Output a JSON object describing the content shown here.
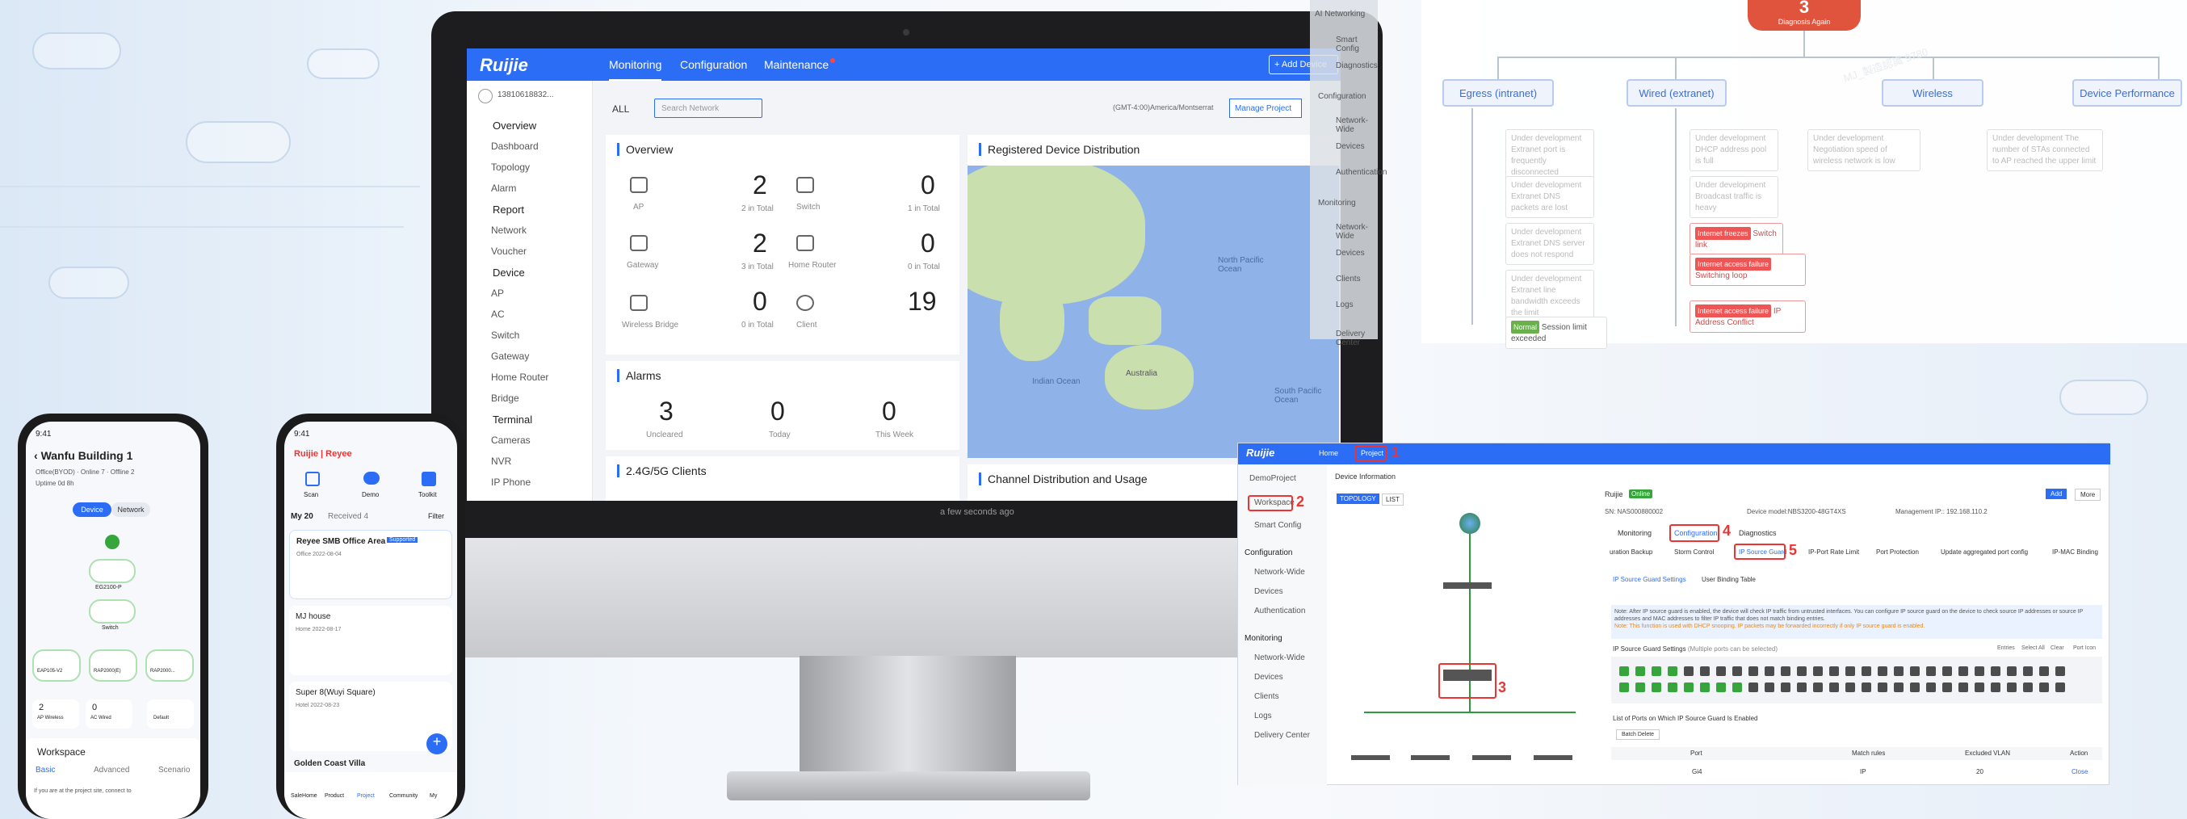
{
  "colors": {
    "accent": "#2c6df6",
    "alert": "#e33333",
    "ok": "#35a53c"
  },
  "monitor": {
    "logo": "Ruijie",
    "nav": [
      "Monitoring",
      "Configuration",
      "Maintenance"
    ],
    "add_device": "+ Add Device",
    "user": "13810618832...",
    "filter": "ALL",
    "search_placeholder": "Search Network",
    "timezone": "(GMT-4:00)America/Montserrat",
    "manage_project": "Manage Project",
    "sidebar": {
      "overview": "Overview",
      "overview_items": [
        "Dashboard",
        "Topology",
        "Alarm"
      ],
      "report": "Report",
      "report_items": [
        "Network",
        "Voucher"
      ],
      "device": "Device",
      "device_items": [
        "AP",
        "AC",
        "Switch",
        "Gateway",
        "Home Router",
        "Bridge"
      ],
      "terminal": "Terminal",
      "terminal_items": [
        "Cameras",
        "NVR",
        "IP Phone"
      ]
    },
    "overview": {
      "title": "Overview",
      "items": [
        {
          "label": "AP",
          "value": "2",
          "total": "2 in Total"
        },
        {
          "label": "Switch",
          "value": "0",
          "total": "1 in Total"
        },
        {
          "label": "Gateway",
          "value": "2",
          "total": "3 in Total"
        },
        {
          "label": "Home Router",
          "value": "0",
          "total": "0 in Total"
        },
        {
          "label": "Wireless Bridge",
          "value": "0",
          "total": "0 in Total"
        },
        {
          "label": "Client",
          "value": "19",
          "total": ""
        }
      ]
    },
    "alarms": {
      "title": "Alarms",
      "items": [
        {
          "value": "3",
          "label": "Uncleared"
        },
        {
          "value": "0",
          "label": "Today"
        },
        {
          "value": "0",
          "label": "This Week"
        }
      ]
    },
    "clients_title": "2.4G/5G Clients",
    "map_title": "Registered Device Distribution",
    "map_labels": [
      "North Pacific Ocean",
      "Indian Ocean",
      "South Pacific Ocean",
      "Australia"
    ],
    "channel_title": "Channel Distribution and Usage",
    "updated": "a few seconds ago"
  },
  "overlay": {
    "items": [
      "AI Networking",
      "Smart Config",
      "Diagnostics",
      "Configuration",
      "Network-Wide",
      "Devices",
      "Authentication",
      "Monitoring",
      "Network-Wide",
      "Devices",
      "Clients",
      "Logs",
      "Delivery Center"
    ]
  },
  "diagram": {
    "root": "3",
    "root_sub": "Diagnosis Again",
    "categories": [
      "Egress (intranet)",
      "Wired (extranet)",
      "Wireless",
      "Device Performance"
    ],
    "egress": [
      "Under development Extranet port is frequently disconnected",
      "Under development Extranet DNS packets are lost",
      "Under development Extranet DNS server does not respond",
      "Under development Extranet line bandwidth exceeds the limit"
    ],
    "normal": "Normal",
    "normal_text": "Session limit exceeded",
    "wired": [
      "Under development DHCP address pool is full",
      "Under development Broadcast traffic is heavy"
    ],
    "wired_alerts": [
      {
        "tag": "Internet freezes",
        "text": "Switch link"
      },
      {
        "tag": "Internet access failure",
        "text": "Switching loop"
      },
      {
        "tag": "Internet access failure",
        "text": "IP Address Conflict"
      }
    ],
    "wireless": "Under development Negotiation speed of wireless network is low",
    "perf": "Under development The number of STAs connected to AP reached the upper limit",
    "watermark": "MJ_製造認識 9780"
  },
  "shot": {
    "nav": [
      "Home",
      "Project"
    ],
    "side": [
      "DemoProject",
      "Workspace",
      "Smart Config",
      "Configuration",
      "Network-Wide",
      "Devices",
      "Authentication",
      "Monitoring",
      "Network-Wide",
      "Devices",
      "Clients",
      "Logs",
      "Delivery Center"
    ],
    "header": "Device Information",
    "tabs_left": [
      "TOPOLOGY",
      "LIST"
    ],
    "device_title": "Ruijie",
    "status": "Online",
    "sn": "SN: NAS000880002",
    "model": "Device model:NBS3200-48GT4XS",
    "ip": "Management IP:: 192.168.110.2",
    "tabs": [
      "Monitoring",
      "Configuration",
      "Diagnostics"
    ],
    "subtabs": [
      "uration Backup",
      "Storm Control",
      "IP Source Guard",
      "IP-Port Rate Limit",
      "Port Protection",
      "Update aggregated port config",
      "IP-MAC Binding"
    ],
    "inner_tabs": [
      "IP Source Guard Settings",
      "User Binding Table"
    ],
    "note": "Note: After IP source guard is enabled, the device will check IP traffic from untrusted interfaces. You can configure IP source guard on the device to check source IP addresses or source IP addresses and MAC addresses to filter IP traffic that does not match binding entries.",
    "note2": "Note: This function is used with DHCP snooping. IP packets may be forwarded incorrectly if only IP source guard is enabled.",
    "settings_label": "IP Source Guard Settings",
    "settings_hint": "(Multiple ports can be selected)",
    "legend": [
      "Entries",
      "Select All",
      "Clear",
      "Port Icon"
    ],
    "list_title": "List of Ports on Which IP Source Guard Is Enabled",
    "batch": "Batch Delete",
    "columns": [
      "Port",
      "Match rules",
      "Excluded VLAN",
      "Action"
    ],
    "row": [
      "Gi4",
      "IP",
      "20",
      "Close"
    ],
    "steps": [
      "1",
      "2",
      "3",
      "4",
      "5"
    ],
    "btn": "Add",
    "more": "More"
  },
  "phone1": {
    "time": "9:41",
    "title": "Wanfu Building 1",
    "meta": [
      "Office(BYOD)",
      "Online 7",
      "Offline 2"
    ],
    "uptime": "Uptime 0d 8h",
    "toggle": [
      "Device",
      "Network"
    ],
    "nodes": [
      "EG2100-P",
      "Switch"
    ],
    "leaves": [
      "EAP105-V2",
      "RAP2000(E)",
      "RAP2000..."
    ],
    "stats": [
      {
        "v": "2",
        "l": "AP Wireless"
      },
      {
        "v": "0",
        "l": "AC Wired"
      },
      {
        "v": "",
        "l": "Default"
      }
    ],
    "workspace": "Workspace",
    "tabs": [
      "Basic",
      "Advanced",
      "Scenario"
    ],
    "hint": "If you are at the project site,  connect to"
  },
  "phone2": {
    "time": "9:41",
    "logo": "Ruijie",
    "brand": "Reyee",
    "quick": [
      "Scan",
      "Demo",
      "Toolkit"
    ],
    "tabs": [
      "My 20",
      "Received 4"
    ],
    "filter": "Filter",
    "projects": [
      {
        "name": "Reyee SMB Office Area",
        "badge": "Supported",
        "type": "Office",
        "date": "2022-08-04"
      },
      {
        "name": "MJ house",
        "type": "Home",
        "date": "2022-08-17"
      },
      {
        "name": "Super 8(Wuyi Square)",
        "type": "Hotel",
        "date": "2022-08-23"
      },
      {
        "name": "Golden Coast Villa"
      }
    ],
    "nav": [
      "SaleHome",
      "Product",
      "Project",
      "Community",
      "My"
    ]
  }
}
